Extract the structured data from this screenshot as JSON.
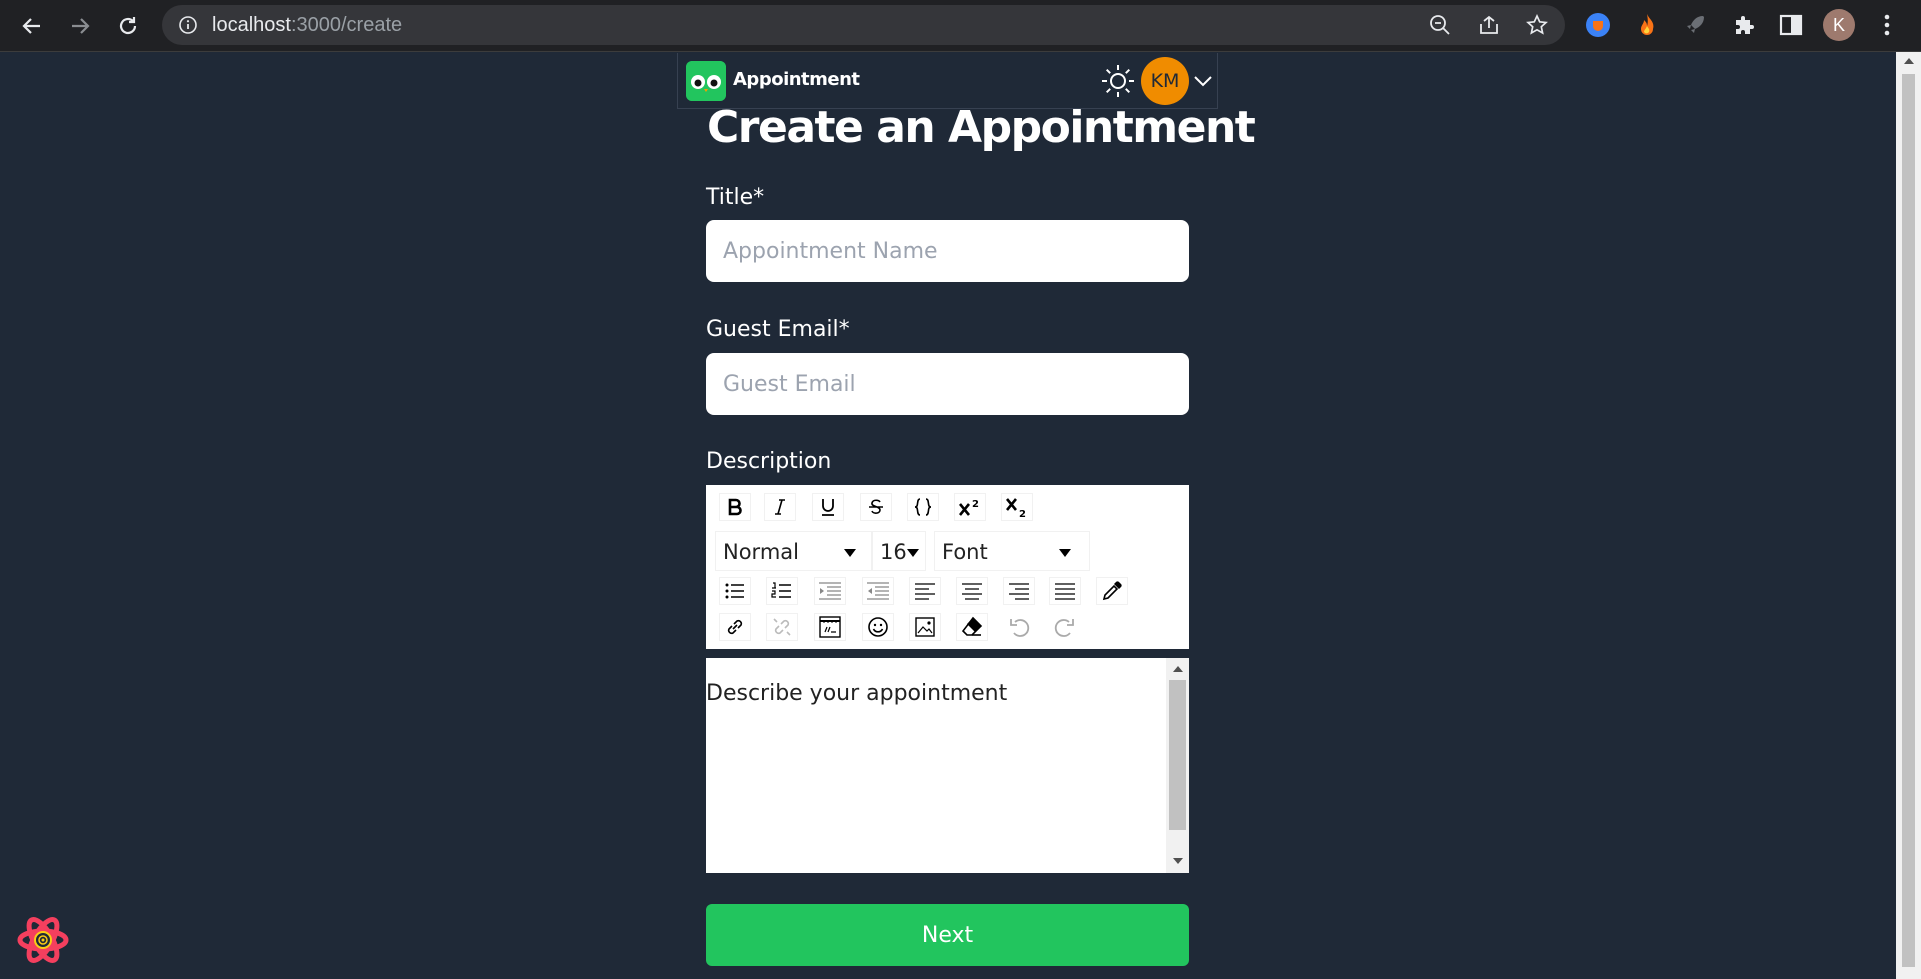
{
  "browser": {
    "url_host": "localhost",
    "url_path": ":3000/create",
    "profile_initial": "K"
  },
  "header": {
    "brand": "Appointment",
    "avatar_initials": "KM"
  },
  "form": {
    "heading": "Create an Appointment",
    "title_label": "Title*",
    "title_placeholder": "Appointment Name",
    "email_label": "Guest Email*",
    "email_placeholder": "Guest Email",
    "description_label": "Description",
    "editor": {
      "block_type": "Normal",
      "font_size": "16",
      "font_family": "Font",
      "text": "Describe your appointment"
    },
    "next_label": "Next"
  },
  "colors": {
    "page_bg": "#1f2937",
    "accent_green": "#22c55e",
    "avatar_orange": "#f08c00"
  }
}
